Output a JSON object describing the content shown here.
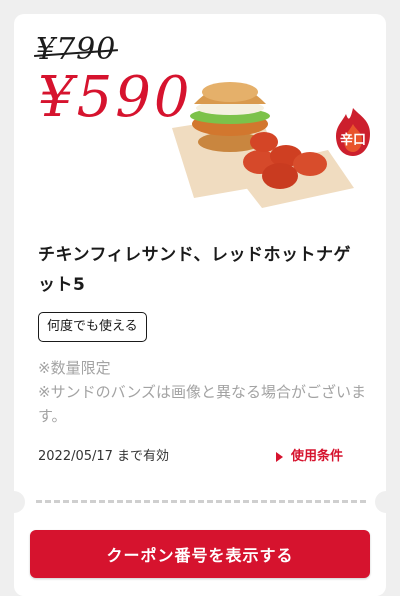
{
  "coupon": {
    "original_price": "¥790",
    "sale_price": "¥590",
    "spicy_badge": "辛口",
    "product_name": "チキンフィレサンド、レッドホットナゲット5",
    "usage_tag": "何度でも使える",
    "notes": [
      "※数量限定",
      "※サンドのバンズは画像と異なる場合がございます。"
    ],
    "expiry": "2022/05/17 まで有効",
    "terms_link": "使用条件",
    "cta_button": "クーポン番号を表示する"
  },
  "colors": {
    "accent": "#d6132e",
    "background": "#efefef"
  }
}
